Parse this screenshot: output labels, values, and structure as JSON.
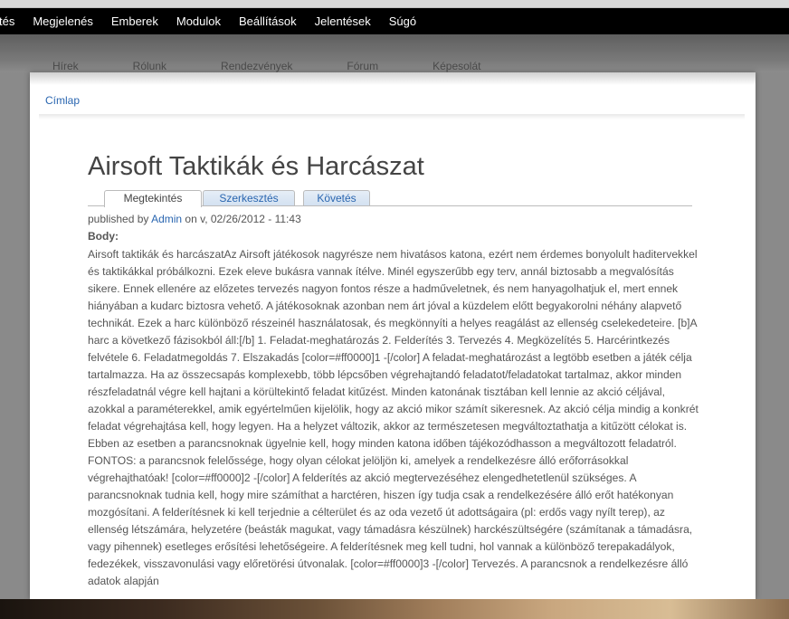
{
  "admin_menu": {
    "items": [
      "tés",
      "Megjelenés",
      "Emberek",
      "Modulok",
      "Beállítások",
      "Jelentések",
      "Súgó"
    ]
  },
  "site_nav": {
    "items": [
      "Hírek",
      "Rólunk",
      "Rendezvények",
      "Fórum",
      "Képesolát"
    ]
  },
  "breadcrumb": {
    "home": "Címlap"
  },
  "node": {
    "title": "Airsoft Taktikák és Harcászat",
    "tabs": [
      "Megtekintés",
      "Szerkesztés",
      "Követés"
    ],
    "meta": {
      "prefix": "published by",
      "author": "Admin",
      "suffix": "on v, 02/26/2012 - 11:43"
    },
    "body_label": "Body:",
    "body": "Airsoft taktikák és harcászatAz Airsoft játékosok nagyrésze nem hivatásos katona, ezért nem érdemes bonyolult haditervekkel és taktikákkal próbálkozni. Ezek eleve bukásra vannak ítélve. Minél egyszerűbb egy terv, annál biztosabb a megvalósítás sikere. Ennek ellenére az előzetes tervezés nagyon fontos része a hadműveletnek, és nem hanyagolhatjuk el, mert ennek hiányában a kudarc biztosra vehető. A játékosoknak azonban nem árt jóval a küzdelem előtt begyakorolni néhány alapvető technikát. Ezek a harc különböző részeinél használatosak, és megkönnyíti a helyes reagálást az ellenség cselekedeteire. [b]A harc a következő fázisokból áll:[/b] 1. Feladat-meghatározás 2. Felderítés 3. Tervezés 4. Megközelítés 5. Harcérintkezés felvétele 6. Feladatmegoldás 7. Elszakadás [color=#ff0000]1 -[/color] A feladat-meghatározást a legtöbb esetben a játék célja tartalmazza. Ha az összecsapás komplexebb, több lépcsőben végrehajtandó feladatot/feladatokat tartalmaz, akkor minden részfeladatnál végre kell hajtani a körültekintő feladat kitűzést. Minden katonának tisztában kell lennie az akció céljával, azokkal a paraméterekkel, amik egyértelműen kijelölik, hogy az akció mikor számít sikeresnek. Az akció célja mindig a konkrét feladat végrehajtása kell, hogy legyen. Ha a helyzet változik, akkor az természetesen megváltoztathatja a kitűzött célokat is. Ebben az esetben a parancsnoknak ügyelnie kell, hogy minden katona időben tájékozódhasson a megváltozott feladatról. FONTOS: a parancsnok felelőssége, hogy olyan célokat jelöljön ki, amelyek a rendelkezésre álló erőforrásokkal végrehajthatóak! [color=#ff0000]2 -[/color] A felderítés az akció megtervezéséhez elengedhetetlenül szükséges. A parancsnoknak tudnia kell, hogy mire számíthat a harctéren, hiszen így tudja csak a rendelkezésére álló erőt hatékonyan mozgósítani. A felderítésnek ki kell terjednie a célterület és az oda vezető út adottságaira (pl: erdős vagy nyílt terep), az ellenség létszámára, helyzetére (beásták magukat, vagy támadásra készülnek) harckészültségére (számítanak a támadásra, vagy pihennek) esetleges erősítési lehetőségeire. A felderítésnek meg kell tudni, hol vannak a különböző terepakadályok, fedezékek, visszavonulási vagy előretörési útvonalak. [color=#ff0000]3 -[/color] Tervezés. A parancsnok a rendelkezésre álló adatok alapján"
  }
}
